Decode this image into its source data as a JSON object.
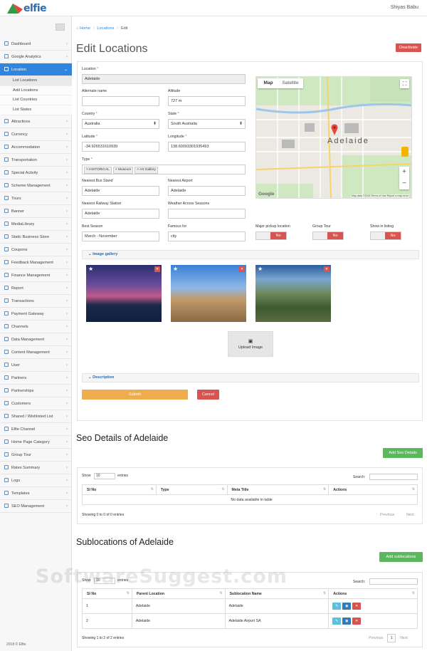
{
  "header": {
    "logo_text": "elfie",
    "user_name": "Shiyas Babu"
  },
  "sidebar": {
    "items": [
      {
        "label": "Dashboard",
        "icon": "home-icon"
      },
      {
        "label": "Google Analytics",
        "icon": "chart-icon"
      },
      {
        "label": "Location",
        "icon": "location-icon",
        "active": true
      },
      {
        "label": "Attractions",
        "icon": "camera-icon"
      },
      {
        "label": "Currency",
        "icon": "money-icon"
      },
      {
        "label": "Accommodation",
        "icon": "bed-icon"
      },
      {
        "label": "Transportation",
        "icon": "car-icon"
      },
      {
        "label": "Special Activity",
        "icon": "star-icon"
      },
      {
        "label": "Scheme Management",
        "icon": "list-icon"
      },
      {
        "label": "Tours",
        "icon": "map-icon"
      },
      {
        "label": "Banner",
        "icon": "image-icon"
      },
      {
        "label": "MediaLibrary",
        "icon": "folder-icon"
      },
      {
        "label": "Static Business Store",
        "icon": "store-icon"
      },
      {
        "label": "Coupons",
        "icon": "tag-icon"
      },
      {
        "label": "Feedback Management",
        "icon": "comment-icon"
      },
      {
        "label": "Finance Management",
        "icon": "finance-icon"
      },
      {
        "label": "Report",
        "icon": "report-icon"
      },
      {
        "label": "Transactions",
        "icon": "exchange-icon"
      },
      {
        "label": "Payment Gateway",
        "icon": "card-icon"
      },
      {
        "label": "Channels",
        "icon": "channel-icon"
      },
      {
        "label": "Data Management",
        "icon": "database-icon"
      },
      {
        "label": "Content Management",
        "icon": "content-icon"
      },
      {
        "label": "User",
        "icon": "user-icon"
      },
      {
        "label": "Partners",
        "icon": "partner-icon"
      },
      {
        "label": "Partnerships",
        "icon": "handshake-icon"
      },
      {
        "label": "Customers",
        "icon": "customers-icon"
      },
      {
        "label": "Shared / Wishlisted List",
        "icon": "heart-icon"
      },
      {
        "label": "Elfie Channel",
        "icon": "tv-icon"
      },
      {
        "label": "Home Page Category",
        "icon": "category-icon"
      },
      {
        "label": "Group Tour",
        "icon": "group-icon"
      },
      {
        "label": "Rates Summary",
        "icon": "rates-icon"
      },
      {
        "label": "Logs",
        "icon": "log-icon"
      },
      {
        "label": "Templates",
        "icon": "template-icon"
      },
      {
        "label": "SEO Management",
        "icon": "seo-icon"
      }
    ],
    "location_submenu": [
      "List Locations",
      "Add Locations",
      "List Countries",
      "List States"
    ],
    "copyright": "2018 © Elfie."
  },
  "breadcrumb": {
    "home": "Home",
    "section": "Locations",
    "current": "Edit"
  },
  "page": {
    "title": "Edit Locations",
    "deactivate_label": "Deactivate"
  },
  "form": {
    "location_label": "Location",
    "location_value": "Adelaide",
    "alt_name_label": "Alternate name",
    "alt_name_value": "",
    "altitude_label": "Altitude",
    "altitude_value": "727 m",
    "country_label": "Country",
    "country_value": "Australia",
    "state_label": "State",
    "state_value": "South Australia",
    "latitude_label": "Latitude",
    "latitude_value": "-34.926531610939",
    "longitude_label": "Longitude",
    "longitude_value": "138.60093301935493",
    "type_label": "Type",
    "type_tags": [
      "HISTORICAL",
      "Museum",
      "Art Gallery"
    ],
    "bus_label": "Nearest Bus Stand",
    "bus_value": "Adelaide",
    "airport_label": "Nearest Airport",
    "airport_value": "Adelaide",
    "railway_label": "Nearest Railway Station",
    "railway_value": "Adelaide",
    "weather_label": "Weather Across Seasons",
    "weather_value": "",
    "season_label": "Best Season",
    "season_value": "March - November",
    "famous_label": "Famous for",
    "famous_value": "city",
    "pickup_label": "Major pickup location",
    "pickup_value": "No",
    "group_tour_label": "Group Tour",
    "group_tour_value": "No",
    "listing_label": "Show in listing",
    "listing_value": "No",
    "gallery_label": "Image gallery",
    "upload_label": "Upload Image",
    "description_label": "Description",
    "submit_label": "Submit",
    "cancel_label": "Cancel"
  },
  "map": {
    "tab_map": "Map",
    "tab_satellite": "Satellite",
    "city_label": "Adelaide",
    "footer": "Map data ©2018  Terms of Use  Report a map error",
    "google": "Google"
  },
  "seo": {
    "title": "Seo Details of Adelaide",
    "add_label": "Add Seo Details",
    "show_label": "Show",
    "entries_value": "10",
    "entries_label": "entries",
    "search_label": "Search:",
    "columns": [
      "Sl No",
      "Type",
      "Meta Title",
      "Actions"
    ],
    "empty": "No data available in table",
    "info": "Showing 0 to 0 of 0 entries",
    "prev": "Previous",
    "next": "Next"
  },
  "subloc": {
    "title": "Sublocations of Adelaide",
    "add_label": "Add sublocations",
    "show_label": "Show",
    "entries_value": "10",
    "entries_label": "entries",
    "search_label": "Search:",
    "columns": [
      "Sl No",
      "Parent Location",
      "Sublocation Name",
      "Actions"
    ],
    "rows": [
      {
        "sl": "1",
        "parent": "Adelaide",
        "name": "Adelaide"
      },
      {
        "sl": "2",
        "parent": "Adelaide",
        "name": "Adelaide Airport SA"
      }
    ],
    "info": "Showing 1 to 2 of 2 entries",
    "prev": "Previous",
    "page": "1",
    "next": "Next"
  },
  "watermark": "SoftwareSuggest.com"
}
